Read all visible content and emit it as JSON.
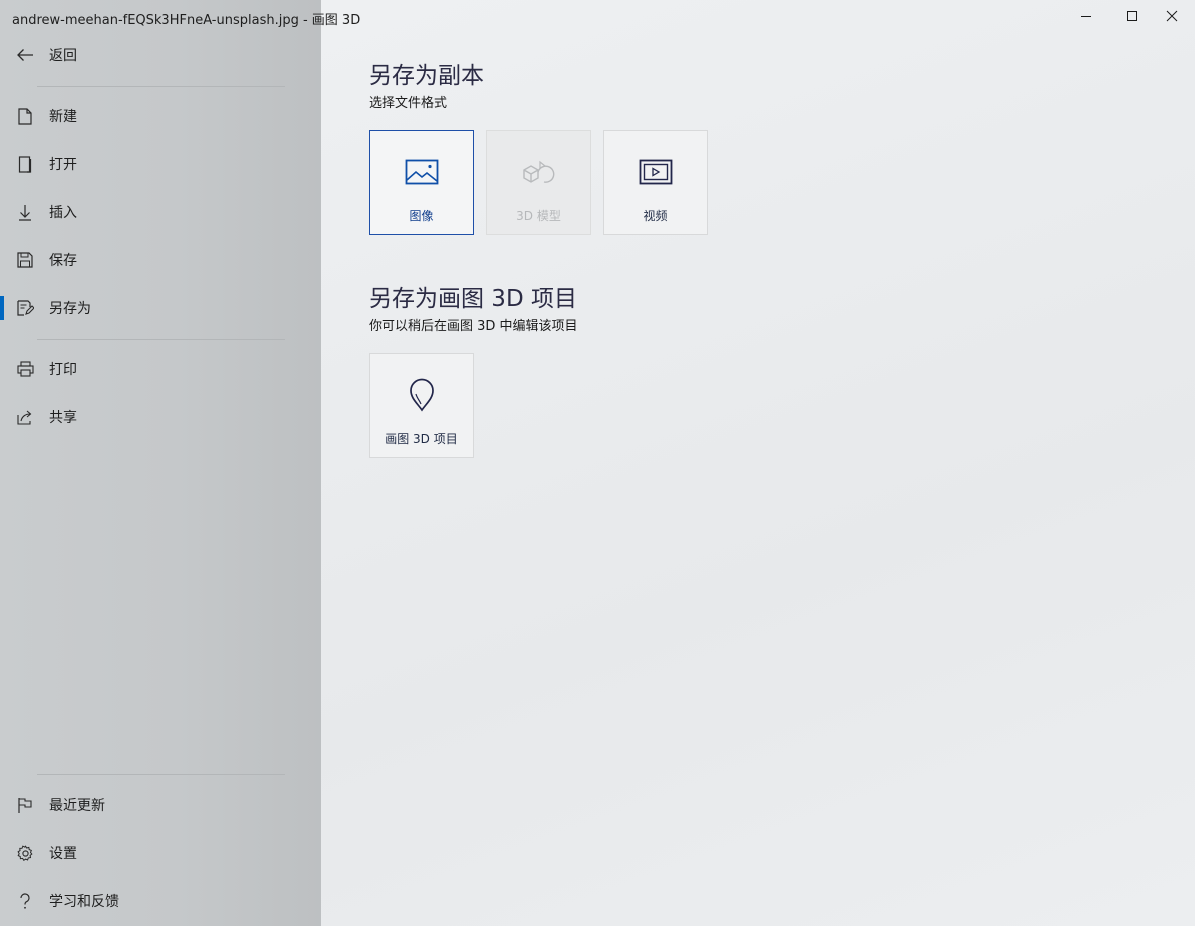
{
  "window": {
    "title": "andrew-meehan-fEQSk3HFneA-unsplash.jpg - 画图 3D",
    "minimize_icon": "minimize-icon",
    "maximize_icon": "maximize-icon",
    "close_icon": "close-icon"
  },
  "sidebar": {
    "back": {
      "label": "返回",
      "icon": "back-arrow-icon"
    },
    "items": [
      {
        "id": "new",
        "label": "新建",
        "icon": "new-document-icon"
      },
      {
        "id": "open",
        "label": "打开",
        "icon": "open-icon"
      },
      {
        "id": "insert",
        "label": "插入",
        "icon": "insert-download-icon"
      },
      {
        "id": "save",
        "label": "保存",
        "icon": "save-floppy-icon"
      },
      {
        "id": "save-as",
        "label": "另存为",
        "icon": "save-as-icon",
        "active": true
      },
      {
        "id": "print",
        "label": "打印",
        "icon": "printer-icon"
      },
      {
        "id": "share",
        "label": "共享",
        "icon": "share-icon"
      }
    ],
    "bottom_items": [
      {
        "id": "whats-new",
        "label": "最近更新",
        "icon": "flag-icon"
      },
      {
        "id": "settings",
        "label": "设置",
        "icon": "gear-icon"
      },
      {
        "id": "help",
        "label": "学习和反馈",
        "icon": "question-icon"
      }
    ],
    "accent_color": "#0067c0"
  },
  "main": {
    "copy_section": {
      "title": "另存为副本",
      "subtitle": "选择文件格式",
      "tiles": [
        {
          "id": "image",
          "label": "图像",
          "icon": "image-icon",
          "selected": true
        },
        {
          "id": "3d-model",
          "label": "3D 模型",
          "icon": "3d-shapes-icon",
          "disabled": true
        },
        {
          "id": "video",
          "label": "视频",
          "icon": "video-icon"
        }
      ]
    },
    "project_section": {
      "title": "另存为画图 3D 项目",
      "subtitle": "你可以稍后在画图 3D 中编辑该项目",
      "tiles": [
        {
          "id": "paint3d-project",
          "label": "画图 3D 项目",
          "icon": "paint3d-logo-icon"
        }
      ]
    }
  }
}
